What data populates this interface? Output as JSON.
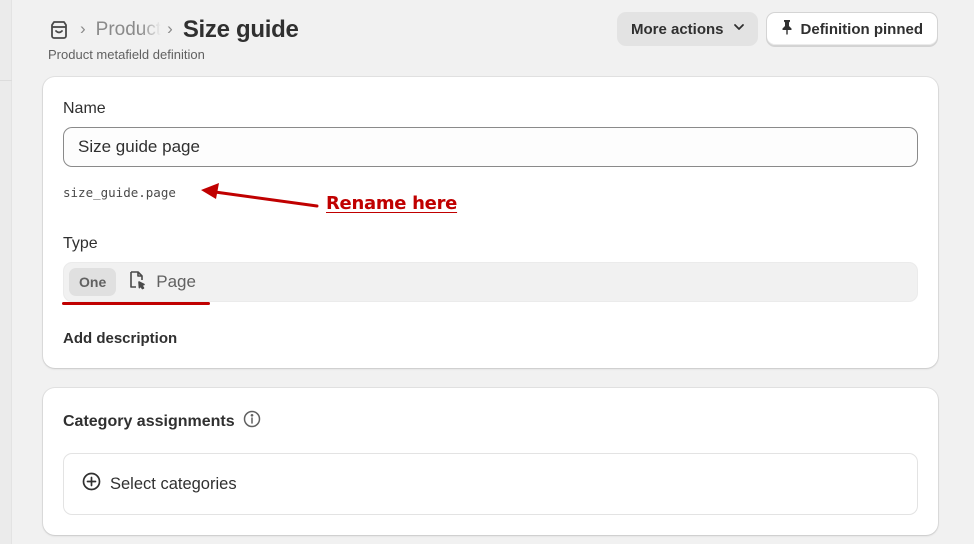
{
  "breadcrumb": {
    "section_label": "Product",
    "title": "Size guide",
    "subtitle": "Product metafield definition"
  },
  "header_actions": {
    "more_actions_label": "More actions",
    "pinned_label": "Definition pinned"
  },
  "definition": {
    "name_label": "Name",
    "name_value": "Size guide page",
    "key": "size_guide.page",
    "type_label": "Type",
    "type_cardinality": "One",
    "type_value": "Page",
    "add_description_label": "Add description"
  },
  "categories": {
    "title": "Category assignments",
    "select_label": "Select categories"
  },
  "annotation": {
    "text": "Rename here",
    "color": "#c00000"
  },
  "icons": {
    "store": "store-icon",
    "info": "info-icon",
    "pin": "pin-icon",
    "chevron": "chevron-down-icon",
    "page": "page-icon",
    "add": "plus-circle-icon"
  }
}
